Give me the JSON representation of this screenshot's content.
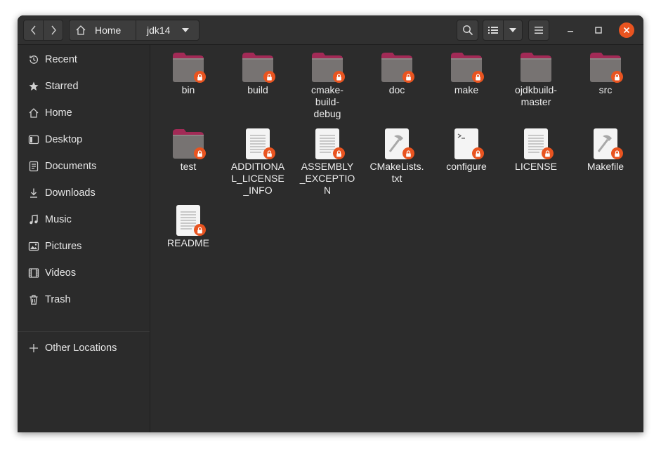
{
  "header": {
    "breadcrumb": {
      "home_label": "Home",
      "current_label": "jdk14"
    }
  },
  "sidebar": {
    "items": [
      {
        "label": "Recent",
        "icon": "clock-icon"
      },
      {
        "label": "Starred",
        "icon": "star-icon"
      },
      {
        "label": "Home",
        "icon": "home-icon"
      },
      {
        "label": "Desktop",
        "icon": "desktop-icon"
      },
      {
        "label": "Documents",
        "icon": "documents-icon"
      },
      {
        "label": "Downloads",
        "icon": "download-icon"
      },
      {
        "label": "Music",
        "icon": "music-icon"
      },
      {
        "label": "Pictures",
        "icon": "pictures-icon"
      },
      {
        "label": "Videos",
        "icon": "videos-icon"
      },
      {
        "label": "Trash",
        "icon": "trash-icon"
      }
    ],
    "other_locations": {
      "label": "Other Locations",
      "icon": "plus-icon"
    }
  },
  "files": [
    {
      "name": "bin",
      "kind": "folder",
      "locked": true
    },
    {
      "name": "build",
      "kind": "folder",
      "locked": true
    },
    {
      "name": "cmake-build-debug",
      "kind": "folder",
      "locked": true
    },
    {
      "name": "doc",
      "kind": "folder",
      "locked": true
    },
    {
      "name": "make",
      "kind": "folder",
      "locked": true
    },
    {
      "name": "ojdkbuild-master",
      "kind": "folder",
      "locked": false
    },
    {
      "name": "src",
      "kind": "folder",
      "locked": true
    },
    {
      "name": "test",
      "kind": "folder",
      "locked": true
    },
    {
      "name": "ADDITIONAL_LICENSE_INFO",
      "kind": "text",
      "locked": true
    },
    {
      "name": "ASSEMBLY_EXCEPTION",
      "kind": "text",
      "locked": true
    },
    {
      "name": "CMakeLists.txt",
      "kind": "build",
      "locked": true
    },
    {
      "name": "configure",
      "kind": "script",
      "locked": true
    },
    {
      "name": "LICENSE",
      "kind": "text",
      "locked": true
    },
    {
      "name": "Makefile",
      "kind": "build",
      "locked": true
    },
    {
      "name": "README",
      "kind": "text",
      "locked": true
    }
  ],
  "colors": {
    "accent": "#e95420",
    "folder": "#777372",
    "folder_tab": "#a22a56",
    "window_bg": "#2c2c2c"
  }
}
